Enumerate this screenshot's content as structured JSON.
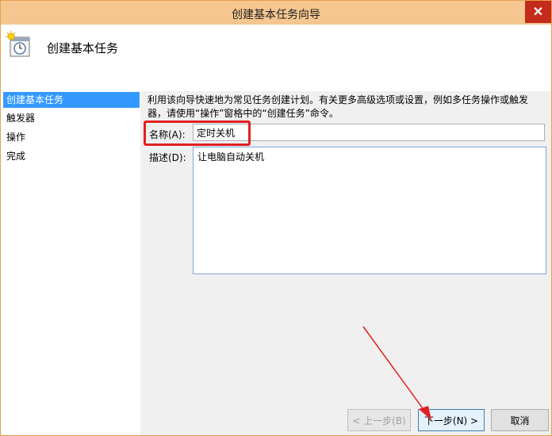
{
  "window": {
    "title": "创建基本任务向导",
    "close_label": "✕"
  },
  "header": {
    "title": "创建基本任务"
  },
  "sidebar": {
    "steps": [
      {
        "label": "创建基本任务",
        "active": true
      },
      {
        "label": "触发器",
        "active": false
      },
      {
        "label": "操作",
        "active": false
      },
      {
        "label": "完成",
        "active": false
      }
    ]
  },
  "main": {
    "description_line1": "利用该向导快速地为常见任务创建计划。有关更多高级选项或设置，例如多任务操作或触发",
    "description_line2": "器，请使用“操作”窗格中的“创建任务”命令。",
    "name_label": "名称(A):",
    "name_value": "定时关机",
    "desc_label": "描述(D):",
    "desc_value": "让电脑自动关机"
  },
  "buttons": {
    "back_label": "< 上一步(B)",
    "next_label": "下一步(N) >",
    "cancel_label": "取消"
  },
  "colors": {
    "titlebar": "#f5c690",
    "close": "#c42b1c",
    "active_step": "#3399ff",
    "highlight": "#e02020"
  }
}
